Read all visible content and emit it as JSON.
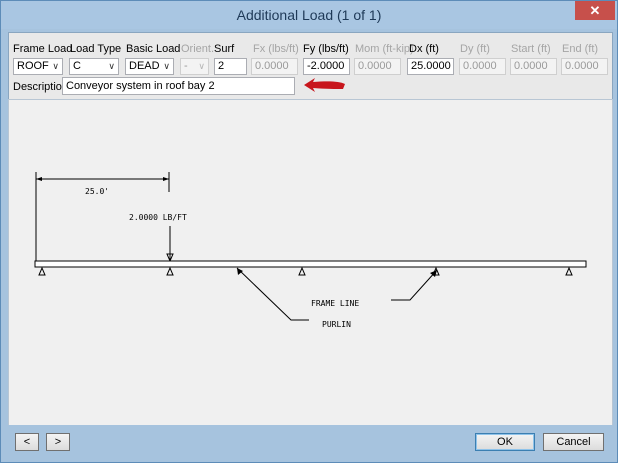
{
  "window": {
    "title": "Additional Load (1 of 1)"
  },
  "titlebar": {
    "close_glyph": "✕"
  },
  "form": {
    "labels": {
      "frame_load": "Frame Load",
      "load_type": "Load Type",
      "basic_load": "Basic Load",
      "orient": "Orient.",
      "surf": "Surf",
      "fx": "Fx  (lbs/ft)",
      "fy": "Fy  (lbs/ft)",
      "mom": "Mom (ft-kip)",
      "dx": "Dx (ft)",
      "dy": "Dy (ft)",
      "start": "Start (ft)",
      "end": "End (ft)",
      "description": "Description"
    },
    "values": {
      "frame_load": "ROOF",
      "load_type": "C",
      "basic_load": "DEAD",
      "orient": "-",
      "surf": "2",
      "fx": "0.0000",
      "fy": "-2.0000",
      "mom": "0.0000",
      "dx": "25.0000",
      "dy": "0.0000",
      "start": "0.0000",
      "end": "0.0000",
      "description": "Conveyor system in roof bay 2"
    },
    "annotation_color": "#c8161d"
  },
  "diagram": {
    "dimension_label": "25.0'",
    "load_label": "2.0000 LB/FT",
    "frame_line_label": "FRAME LINE",
    "purlin_label": "PURLIN"
  },
  "buttons": {
    "prev": "<",
    "next": ">",
    "ok": "OK",
    "cancel": "Cancel"
  }
}
